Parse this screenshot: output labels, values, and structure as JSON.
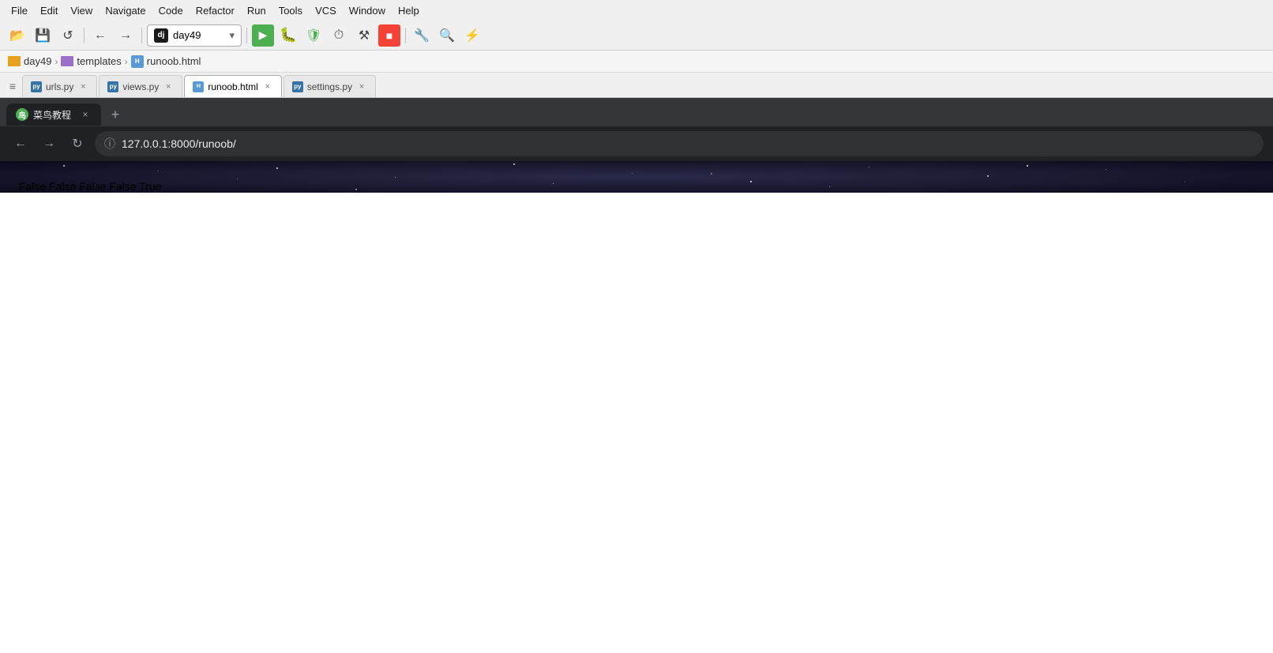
{
  "menu": {
    "items": [
      "File",
      "Edit",
      "View",
      "Navigate",
      "Code",
      "Refactor",
      "Run",
      "Tools",
      "VCS",
      "Window",
      "Help"
    ]
  },
  "toolbar": {
    "project_name": "day49",
    "project_logo": "dj",
    "buttons": {
      "open_label": "📂",
      "save_label": "💾",
      "sync_label": "🔄",
      "back_label": "←",
      "forward_label": "→",
      "run_label": "▶",
      "debug_label": "🐞",
      "coverage_label": "🛡",
      "profile_label": "⏱",
      "build_label": "⚒",
      "stop_label": "■",
      "wrench_label": "🔧",
      "search_label": "🔍",
      "multirun_label": "⚡"
    }
  },
  "breadcrumb": {
    "items": [
      {
        "label": "day49",
        "type": "folder"
      },
      {
        "label": "templates",
        "type": "folder-purple"
      },
      {
        "label": "runoob.html",
        "type": "html"
      }
    ]
  },
  "tabs": [
    {
      "label": "urls.py",
      "type": "py",
      "active": false
    },
    {
      "label": "views.py",
      "type": "py",
      "active": false
    },
    {
      "label": "runoob.html",
      "type": "html",
      "active": true
    },
    {
      "label": "settings.py",
      "type": "py",
      "active": false
    }
  ],
  "browser": {
    "tab_label": "菜鸟教程",
    "favicon_text": "鸟",
    "url": "127.0.0.1:8000/runoob/",
    "page_content": "False False False False True"
  }
}
